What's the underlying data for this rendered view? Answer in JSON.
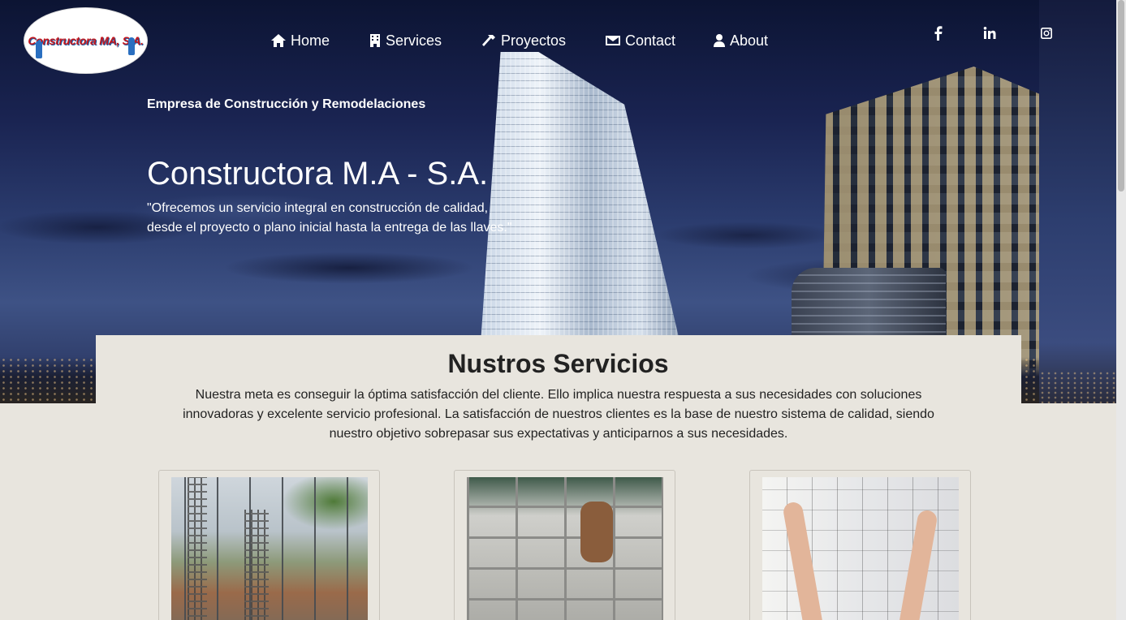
{
  "header": {
    "logo_text": "Constructora MA, S.A.",
    "nav": [
      {
        "label": "Home",
        "icon": "home-icon"
      },
      {
        "label": "Services",
        "icon": "building-icon"
      },
      {
        "label": "Proyectos",
        "icon": "hammer-icon"
      },
      {
        "label": "Contact",
        "icon": "envelope-icon"
      },
      {
        "label": "About",
        "icon": "user-tie-icon"
      }
    ],
    "social": [
      "facebook-icon",
      "linkedin-icon",
      "instagram-icon"
    ]
  },
  "hero": {
    "tagline": "Empresa de Construcción y Remodelaciones",
    "title": "Constructora M.A - S.A.",
    "quote_line1": "\"Ofrecemos un servicio integral en construcción de calidad,",
    "quote_line2": "desde el proyecto o plano inicial hasta la entrega de las llaves.\""
  },
  "services": {
    "title": "Nustros Servicios",
    "description": "Nuestra meta es conseguir la óptima satisfacción del cliente. Ello implica nuestra respuesta a sus necesidades con soluciones innovadoras y excelente servicio profesional. La satisfacción de nuestros clientes es la base de nuestro sistema de calidad, siendo nuestro objetivo sobrepasar sus expectativas y anticiparnos a sus necesidades.",
    "cards": [
      {
        "image": "rebar-construction-photo"
      },
      {
        "image": "block-wall-photo"
      },
      {
        "image": "kitchen-remodel-photo"
      }
    ]
  }
}
